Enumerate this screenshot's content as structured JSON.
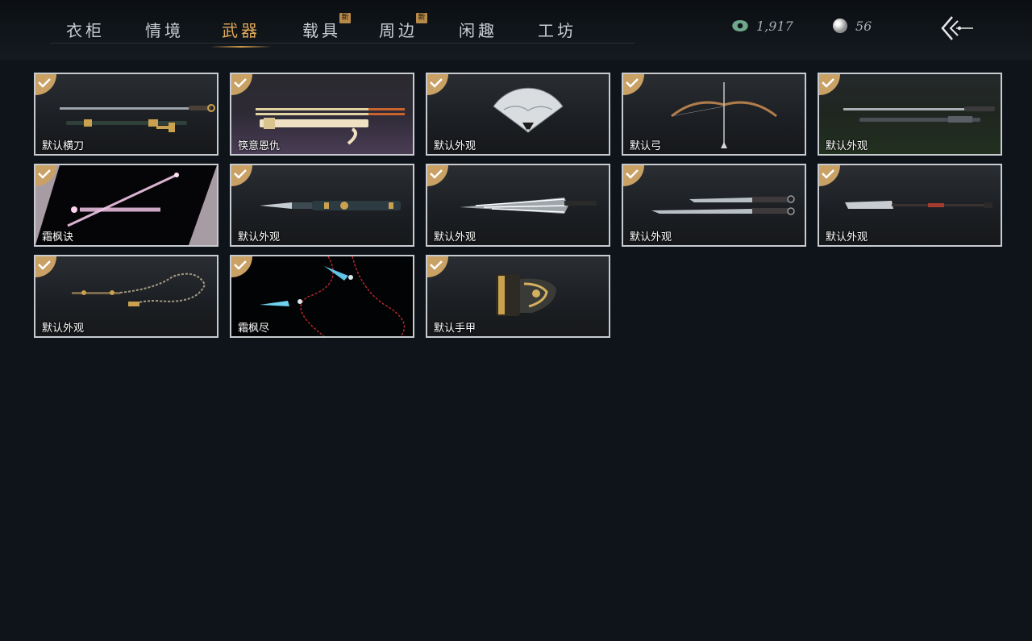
{
  "tabs": [
    {
      "label": "衣柜",
      "active": false,
      "badge": ""
    },
    {
      "label": "情境",
      "active": false,
      "badge": ""
    },
    {
      "label": "武器",
      "active": true,
      "badge": ""
    },
    {
      "label": "载具",
      "active": false,
      "badge": "新"
    },
    {
      "label": "周边",
      "active": false,
      "badge": "新"
    },
    {
      "label": "闲趣",
      "active": false,
      "badge": ""
    },
    {
      "label": "工坊",
      "active": false,
      "badge": ""
    }
  ],
  "currency": {
    "jade": {
      "icon": "jade-coin-icon",
      "value": "1,917"
    },
    "pearl": {
      "icon": "pearl-icon",
      "value": "56"
    }
  },
  "back_icon": "back-arrow-icon",
  "items": [
    {
      "name": "默认横刀",
      "owned": true
    },
    {
      "name": "筷意恩仇",
      "owned": true
    },
    {
      "name": "默认外观",
      "owned": true
    },
    {
      "name": "默认弓",
      "owned": true
    },
    {
      "name": "默认外观",
      "owned": true
    },
    {
      "name": "霜枫诀",
      "owned": true
    },
    {
      "name": "默认外观",
      "owned": true
    },
    {
      "name": "默认外观",
      "owned": true
    },
    {
      "name": "默认外观",
      "owned": true
    },
    {
      "name": "默认外观",
      "owned": true
    },
    {
      "name": "默认外观",
      "owned": true
    },
    {
      "name": "霜枫尽",
      "owned": true
    },
    {
      "name": "默认手甲",
      "owned": true
    }
  ],
  "colors": {
    "accent": "#e0a95c",
    "check": "#c9a165",
    "background": "#0f141a"
  }
}
